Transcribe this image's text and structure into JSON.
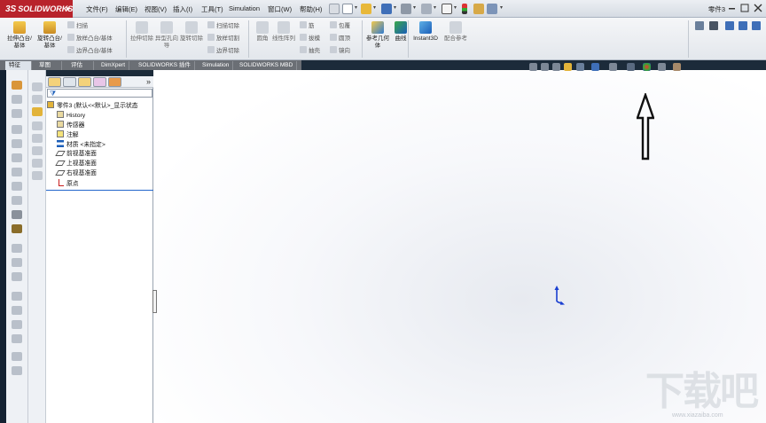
{
  "app": {
    "logo_text": "SOLIDWORKS",
    "logo_prefix": "3S"
  },
  "menu": [
    "文件(F)",
    "编辑(E)",
    "视图(V)",
    "插入(I)",
    "工具(T)",
    "Simulation",
    "窗口(W)",
    "帮助(H)"
  ],
  "document": {
    "title": "零件3"
  },
  "ribbon": {
    "big_buttons": [
      {
        "label": "拉伸凸台/基体",
        "icon": "extrude-boss-icon"
      },
      {
        "label": "旋转凸台/基体",
        "icon": "revolve-boss-icon"
      },
      {
        "label": "拉伸切除",
        "icon": "extrude-cut-icon"
      },
      {
        "label": "异型孔向导",
        "icon": "hole-wizard-icon"
      },
      {
        "label": "旋转切除",
        "icon": "revolve-cut-icon"
      },
      {
        "label": "圆角",
        "icon": "fillet-icon"
      },
      {
        "label": "线性阵列",
        "icon": "linear-pattern-icon"
      },
      {
        "label": "参考几何体",
        "icon": "reference-geometry-icon"
      },
      {
        "label": "曲线",
        "icon": "curves-icon"
      },
      {
        "label": "Instant3D",
        "icon": "instant3d-icon"
      },
      {
        "label": "配合参考",
        "icon": "mate-reference-icon"
      }
    ],
    "small_buttons_col1": [
      "扫描",
      "放样凸台/基体",
      "边界凸台/基体"
    ],
    "small_buttons_col2": [
      "扫描切除",
      "放样切割",
      "边界切除"
    ],
    "small_buttons_col3": [
      "筋",
      "拔模",
      "抽壳"
    ],
    "small_buttons_col4": [
      "包覆",
      "圆顶",
      "镜向"
    ]
  },
  "tabs": [
    {
      "label": "特征",
      "active": true
    },
    {
      "label": "草图",
      "active": false
    },
    {
      "label": "评估",
      "active": false
    },
    {
      "label": "DimXpert",
      "active": false
    },
    {
      "label": "SOLIDWORKS 插件",
      "active": false
    },
    {
      "label": "Simulation",
      "active": false
    },
    {
      "label": "SOLIDWORKS MBD",
      "active": false
    }
  ],
  "feature_tree": {
    "root": "零件3 (默认<<默认>_显示状态",
    "items": [
      {
        "label": "History",
        "icon": "history-folder-icon"
      },
      {
        "label": "传感器",
        "icon": "sensors-folder-icon"
      },
      {
        "label": "注解",
        "icon": "annotations-icon"
      },
      {
        "label": "材质 <未指定>",
        "icon": "material-icon"
      },
      {
        "label": "前视基准面",
        "icon": "front-plane-icon"
      },
      {
        "label": "上视基准面",
        "icon": "top-plane-icon"
      },
      {
        "label": "右视基准面",
        "icon": "right-plane-icon"
      },
      {
        "label": "原点",
        "icon": "origin-icon"
      }
    ],
    "expand_glyph": "»"
  },
  "watermark": {
    "text": "下载吧",
    "url": "www.xiazaiba.com"
  },
  "colors": {
    "brand_red": "#b8232b",
    "triad_blue": "#1a3fd1",
    "selection_blue": "#2266cc"
  }
}
